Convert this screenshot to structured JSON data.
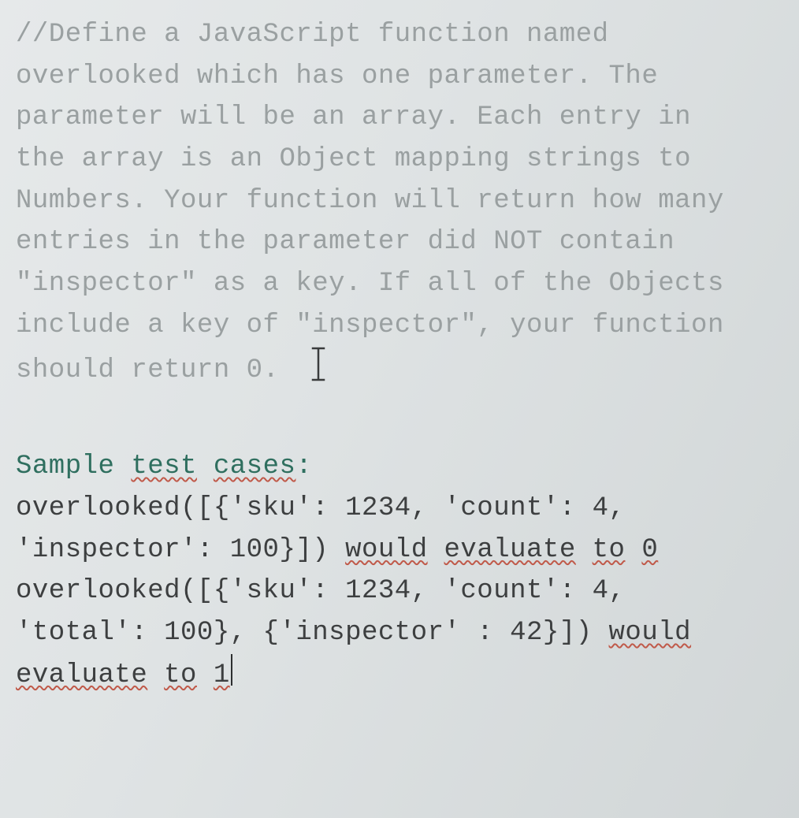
{
  "comment": {
    "l1": "//Define a JavaScript function named",
    "l2": "overlooked which has one parameter. The",
    "l3": "parameter will be an array. Each entry in",
    "l4": "the array is an Object mapping strings to",
    "l5": "Numbers. Your function will return how many",
    "l6": "entries in the parameter did NOT contain",
    "l7": "\"inspector\" as a key. If all of the Objects",
    "l8": "include a key of \"inspector\", your function",
    "l9": "should return 0."
  },
  "sample": {
    "header_a": "Sample ",
    "header_b": "test",
    "header_c": " ",
    "header_d": "cases",
    "header_e": ":",
    "l1": "overlooked([{'sku': 1234, 'count': 4,",
    "l2a": "'inspector': 100}]) ",
    "l2b": "would",
    "l2c": " ",
    "l2d": "evaluate",
    "l2e": " ",
    "l2f": "to",
    "l2g": " ",
    "l2h": "0",
    "l3": "overlooked([{'sku': 1234, 'count': 4,",
    "l4a": "'total': 100}, {'inspector' : 42}]) ",
    "l4b": "would",
    "l5a": "evaluate",
    "l5b": " ",
    "l5c": "to",
    "l5d": " ",
    "l5e": "1"
  },
  "function_spec": {
    "name": "overlooked",
    "parameter": "array of Objects mapping strings to Numbers",
    "returns": "count of entries that did NOT contain 'inspector' as a key",
    "edge_case": "returns 0 if all Objects include key 'inspector'"
  },
  "test_cases": [
    {
      "call": "overlooked([{'sku': 1234, 'count': 4, 'inspector': 100}])",
      "result": 0
    },
    {
      "call": "overlooked([{'sku': 1234, 'count': 4, 'total': 100}, {'inspector' : 42}])",
      "result": 1
    }
  ]
}
